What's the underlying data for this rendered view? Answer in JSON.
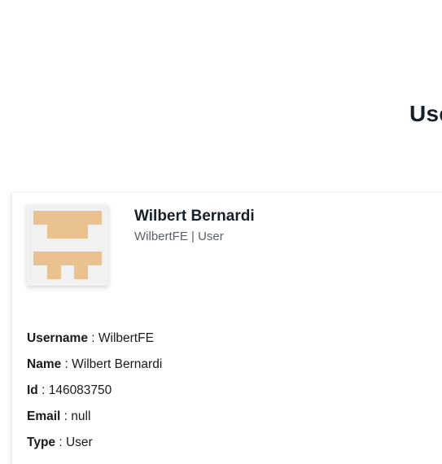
{
  "header": {
    "title": "User Profile"
  },
  "profile": {
    "name": "Wilbert Bernardi",
    "subtitle": "WilbertFE | User",
    "avatar_icon": "identicon-avatar",
    "avatar_colors": {
      "background": "#f1f1f1",
      "pattern": "#e9c28f"
    }
  },
  "details": {
    "username_label": "Username",
    "username_value": "WilbertFE",
    "name_label": "Name",
    "name_value": "Wilbert Bernardi",
    "id_label": "Id",
    "id_value": "146083750",
    "email_label": "Email",
    "email_value": "null",
    "type_label": "Type",
    "type_value": "User",
    "separator": " : "
  }
}
